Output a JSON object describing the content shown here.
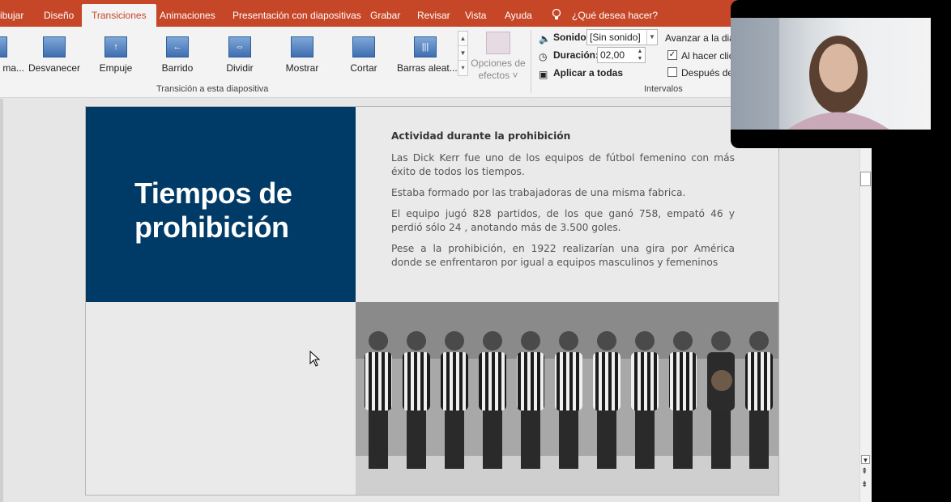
{
  "ribbon_tabs": [
    "ibujar",
    "Diseño",
    "Transiciones",
    "Animaciones",
    "Presentación con diapositivas",
    "Grabar",
    "Revisar",
    "Vista",
    "Ayuda"
  ],
  "tell_me": "¿Qué desea hacer?",
  "gallery": {
    "items": [
      "ma...",
      "Desvanecer",
      "Empuje",
      "Barrido",
      "Dividir",
      "Mostrar",
      "Cortar",
      "Barras aleat..."
    ],
    "group_label": "Transición a esta diapositiva"
  },
  "effects": {
    "line1": "Opciones de",
    "line2": "efectos"
  },
  "timing": {
    "sound_label": "Sonido:",
    "sound_value": "[Sin sonido]",
    "duration_label": "Duración:",
    "duration_value": "02,00",
    "apply_all": "Aplicar a todas",
    "advance_label": "Avanzar a la diap",
    "on_click": "Al hacer clic",
    "after": "Después de:",
    "group_label": "Intervalos"
  },
  "slide": {
    "title_line1": "Tiempos de",
    "title_line2": "prohibición",
    "heading": "Actividad durante la prohibición",
    "paragraphs": [
      "Las Dick Kerr fue uno de los equipos de fútbol femenino con más éxito de todos los tiempos.",
      "Estaba formado por las trabajadoras de una misma fabrica.",
      "El equipo jugó 828 partidos, de los que ganó 758, empató 46 y perdió sólo 24 , anotando más de 3.500 goles.",
      "Pese a la prohibición, en 1922 realizarían una gira por América donde se enfrentaron por igual a equipos masculinos y femeninos"
    ]
  },
  "colors": {
    "tab_bar": "#c64728",
    "title_panel": "#003b68",
    "ribbon": "#f3f3f3"
  }
}
